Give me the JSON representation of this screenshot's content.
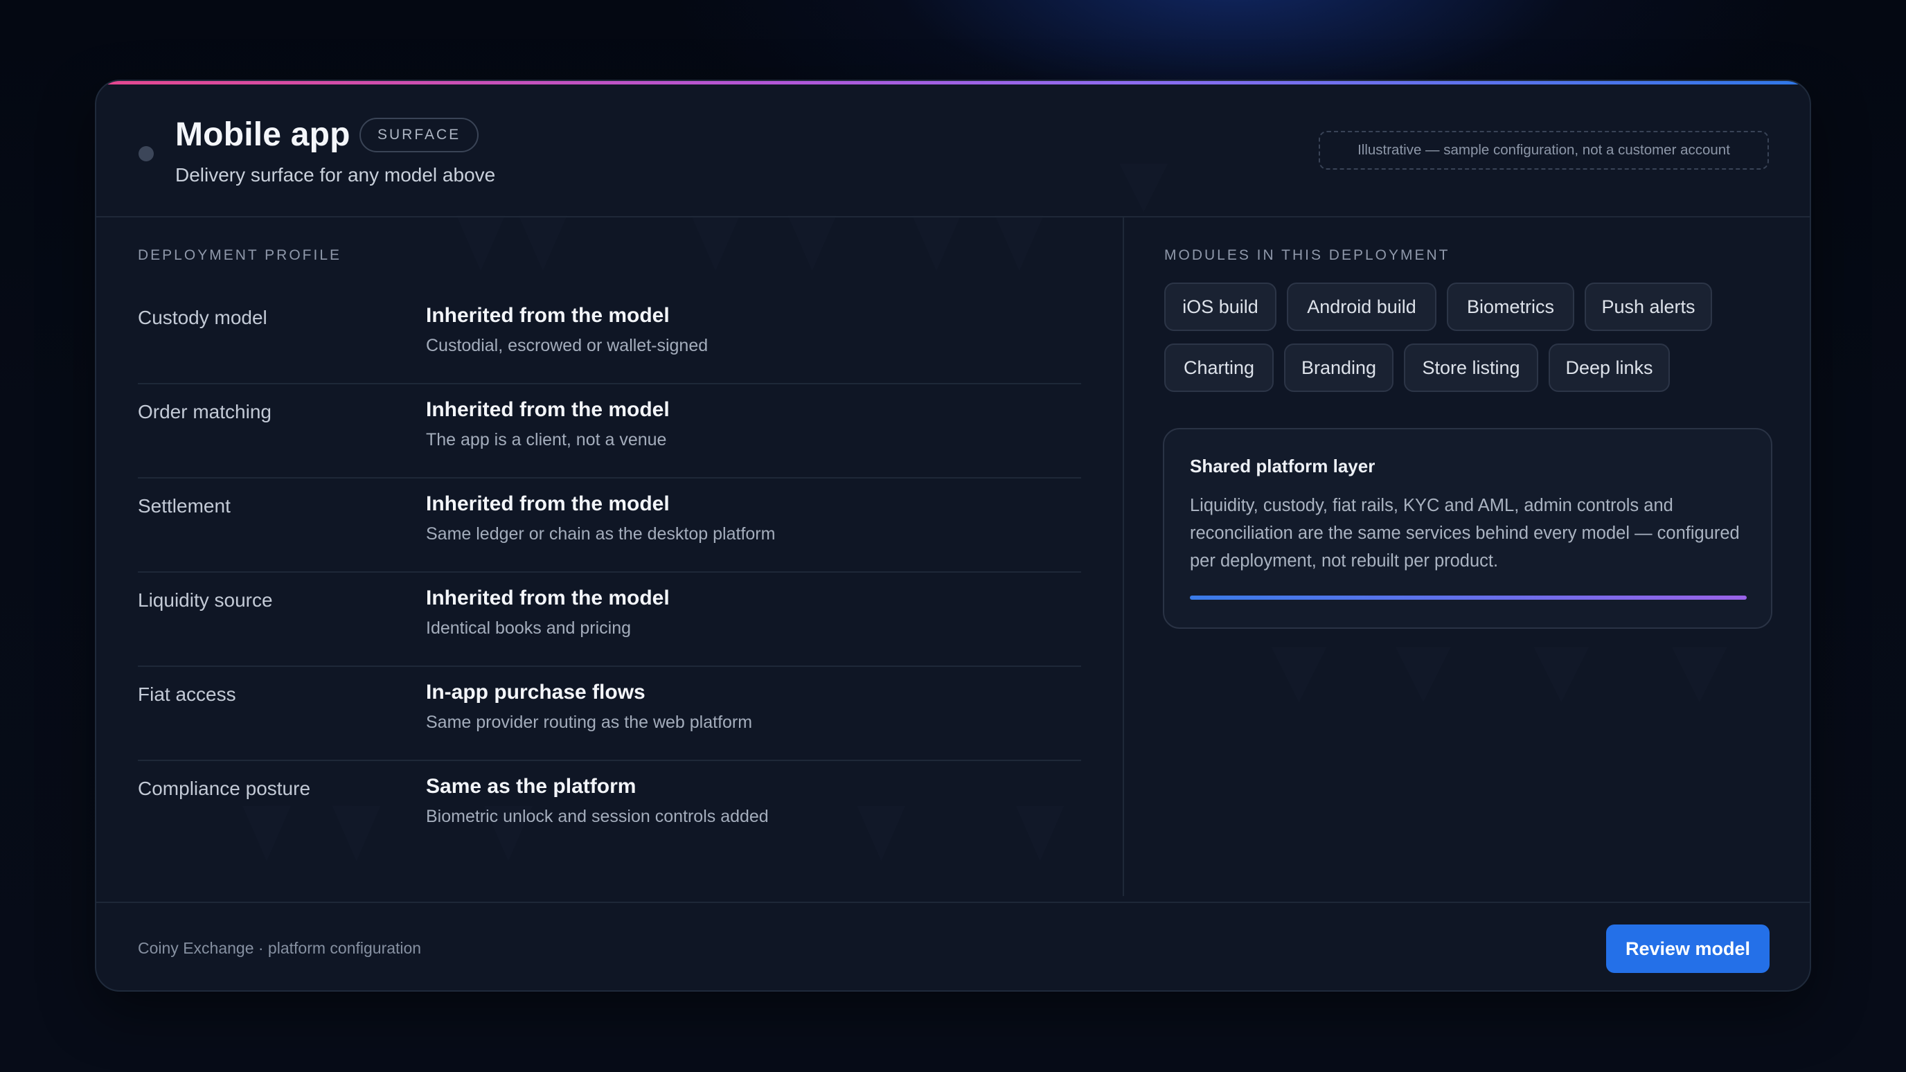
{
  "header": {
    "title": "Mobile app",
    "badge": "SURFACE",
    "subtitle": "Delivery surface for any model above",
    "note": "Illustrative — sample configuration, not a customer account"
  },
  "deployment_profile": {
    "heading": "DEPLOYMENT PROFILE",
    "rows": [
      {
        "label": "Custody model",
        "value": "Inherited from the model",
        "description": "Custodial, escrowed or wallet-signed"
      },
      {
        "label": "Order matching",
        "value": "Inherited from the model",
        "description": "The app is a client, not a venue"
      },
      {
        "label": "Settlement",
        "value": "Inherited from the model",
        "description": "Same ledger or chain as the desktop platform"
      },
      {
        "label": "Liquidity source",
        "value": "Inherited from the model",
        "description": "Identical books and pricing"
      },
      {
        "label": "Fiat access",
        "value": "In-app purchase flows",
        "description": "Same provider routing as the web platform"
      },
      {
        "label": "Compliance posture",
        "value": "Same as the platform",
        "description": "Biometric unlock and session controls added"
      }
    ]
  },
  "modules": {
    "heading": "MODULES IN THIS DEPLOYMENT",
    "items": [
      "iOS build",
      "Android build",
      "Biometrics",
      "Push alerts",
      "Charting",
      "Branding",
      "Store listing",
      "Deep links"
    ]
  },
  "shared_layer": {
    "title": "Shared platform layer",
    "body": "Liquidity, custody, fiat rails, KYC and AML, admin controls and reconciliation are the same services behind every model — configured per deployment, not rebuilt per product."
  },
  "footer": {
    "text": "Coiny Exchange · platform configuration",
    "button_label": "Review model"
  },
  "colors": {
    "accent_button": "#2470e8",
    "card_background": "#0f1625",
    "gradient_start": "#e4488f",
    "gradient_end": "#2f78e8"
  }
}
